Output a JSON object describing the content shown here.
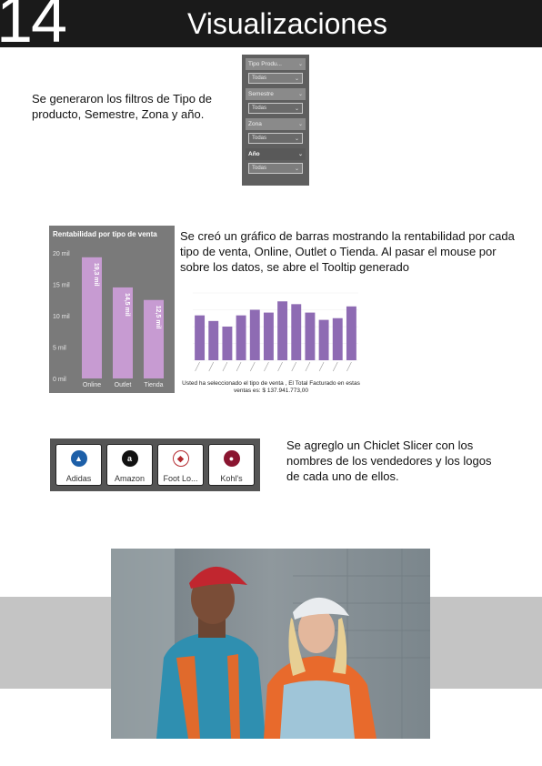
{
  "header": {
    "page_number": "14",
    "title": "Visualizaciones"
  },
  "sections": {
    "filters_text": "Se generaron los filtros de Tipo de producto, Semestre, Zona y año.",
    "chart_text": "Se creó un gráfico de barras mostrando la rentabilidad por cada tipo de venta, Online, Outlet o Tienda. Al pasar el mouse por sobre los datos, se abre el Tooltip generado",
    "chiclet_text": "Se agreglo un Chiclet Slicer con los nombres de los vendedores y los logos de cada uno de ellos."
  },
  "filters": [
    {
      "label": "Tipo Produ...",
      "value": "Todas"
    },
    {
      "label": "Semestre",
      "value": "Todas"
    },
    {
      "label": "Zona",
      "value": "Todas"
    },
    {
      "label": "Año",
      "value": "Todas"
    }
  ],
  "colors": {
    "bar": "#c79bd2",
    "tooltip_bar": "#8e6bb3",
    "header_bg": "#1a1a1a"
  },
  "chart_data": [
    {
      "type": "bar",
      "title": "Rentabilidad por tipo de venta",
      "categories": [
        "Online",
        "Outlet",
        "Tienda"
      ],
      "values": [
        19.3,
        14.5,
        12.5
      ],
      "data_labels": [
        "19,3 mil",
        "14,5 mil",
        "12,5 mil"
      ],
      "y_ticks": [
        "0 mil",
        "5 mil",
        "10 mil",
        "15 mil",
        "20 mil"
      ],
      "ylim": [
        0,
        20
      ],
      "grid": false
    },
    {
      "type": "bar",
      "title": "",
      "values": [
        8,
        7,
        6,
        8,
        9,
        8.5,
        10.5,
        10,
        8.5,
        7.2,
        7.5,
        9.6
      ],
      "ylim": [
        0,
        12
      ],
      "caption": "Usted ha seleccionado el tipo de venta , El Total Facturado en estas ventas es: $ 137.941.773,00"
    }
  ],
  "chiclets": [
    {
      "label": "Adidas",
      "logo": "adidas-logo",
      "color": "#1d5fa8"
    },
    {
      "label": "Amazon",
      "logo": "amazon-logo",
      "color": "#111111"
    },
    {
      "label": "Foot Lo...",
      "logo": "foot-locker-logo",
      "color": "#b3282d"
    },
    {
      "label": "Kohl's",
      "logo": "kohls-logo",
      "color": "#8a1530"
    }
  ]
}
